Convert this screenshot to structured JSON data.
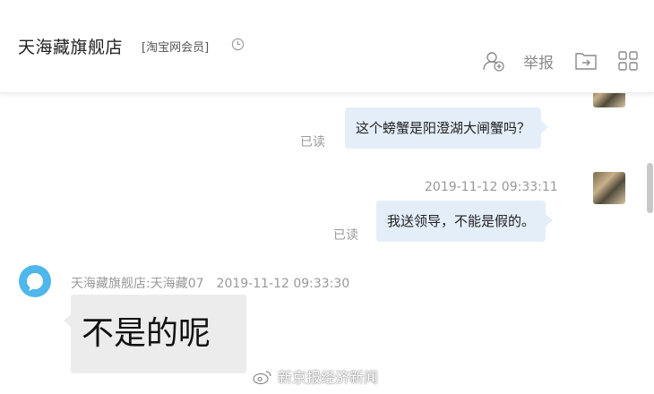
{
  "header": {
    "shop_name": "天海藏旗舰店",
    "member_tag": "[淘宝网会员]",
    "report_label": "举报",
    "icons": [
      "clock-icon",
      "add-contact-icon",
      "folder-forward-icon",
      "grid-apps-icon"
    ]
  },
  "messages": {
    "m1": {
      "text": "这个螃蟹是阳澄湖大闸蟹吗？",
      "read_label": "已读"
    },
    "m2": {
      "timestamp": "2019-11-12 09:33:11",
      "text": "我送领导，不能是假的。",
      "read_label": "已读"
    },
    "m3": {
      "sender": "天海藏旗舰店:天海藏07",
      "timestamp": "2019-11-12 09:33:30",
      "text": "不是的呢"
    }
  },
  "watermark": {
    "text": "新京报经济新闻",
    "icon": "weibo-icon"
  },
  "colors": {
    "bubble_out": "#e4eef9",
    "bubble_in": "#ececec",
    "seller_avatar": "#4fb7ea",
    "meta_text": "#999999"
  }
}
